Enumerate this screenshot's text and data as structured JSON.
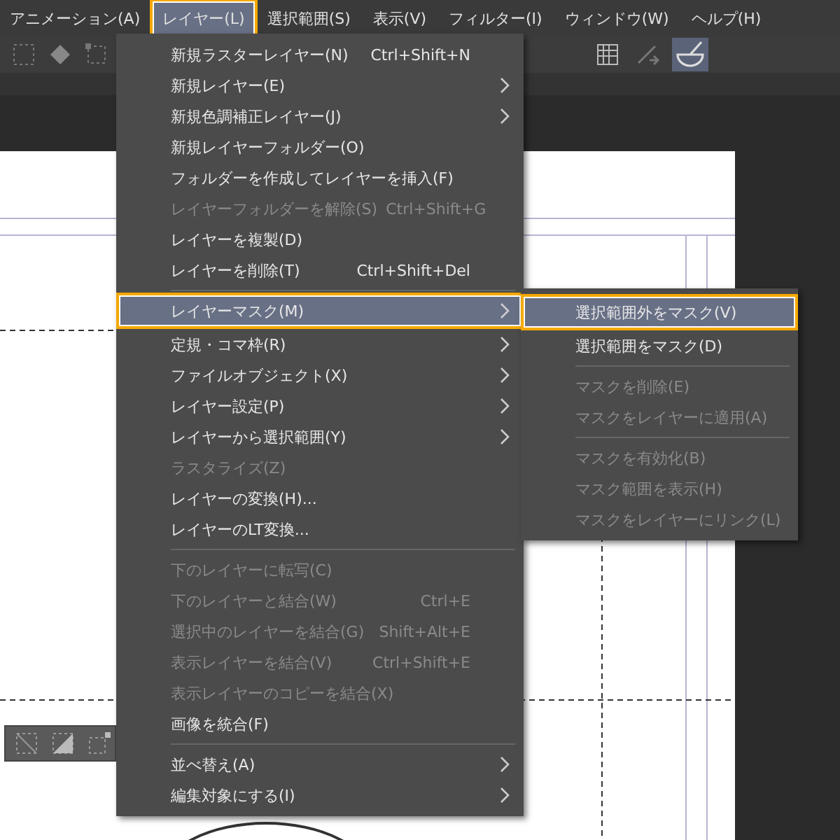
{
  "menu_bar": [
    {
      "label": "アニメーション(A)",
      "selected": false
    },
    {
      "label": "レイヤー(L)",
      "selected": true
    },
    {
      "label": "選択範囲(S)",
      "selected": false
    },
    {
      "label": "表示(V)",
      "selected": false
    },
    {
      "label": "フィルター(I)",
      "selected": false
    },
    {
      "label": "ウィンドウ(W)",
      "selected": false
    },
    {
      "label": "ヘルプ(H)",
      "selected": false
    }
  ],
  "layer_menu": [
    {
      "kind": "item",
      "label": "新規ラスターレイヤー(N)",
      "shortcut": "Ctrl+Shift+N",
      "submenu": false,
      "disabled": false,
      "selected": false
    },
    {
      "kind": "item",
      "label": "新規レイヤー(E)",
      "submenu": true,
      "disabled": false,
      "selected": false
    },
    {
      "kind": "item",
      "label": "新規色調補正レイヤー(J)",
      "submenu": true,
      "disabled": false,
      "selected": false
    },
    {
      "kind": "item",
      "label": "新規レイヤーフォルダー(O)",
      "submenu": false,
      "disabled": false,
      "selected": false
    },
    {
      "kind": "item",
      "label": "フォルダーを作成してレイヤーを挿入(F)",
      "submenu": false,
      "disabled": false,
      "selected": false
    },
    {
      "kind": "item",
      "label": "レイヤーフォルダーを解除(S)",
      "shortcut": "Ctrl+Shift+G",
      "submenu": false,
      "disabled": true,
      "selected": false
    },
    {
      "kind": "item",
      "label": "レイヤーを複製(D)",
      "submenu": false,
      "disabled": false,
      "selected": false
    },
    {
      "kind": "item",
      "label": "レイヤーを削除(T)",
      "shortcut": "Ctrl+Shift+Del",
      "submenu": false,
      "disabled": false,
      "selected": false
    },
    {
      "kind": "separator"
    },
    {
      "kind": "item",
      "label": "レイヤーマスク(M)",
      "submenu": true,
      "disabled": false,
      "selected": true
    },
    {
      "kind": "item",
      "label": "定規・コマ枠(R)",
      "submenu": true,
      "disabled": false,
      "selected": false
    },
    {
      "kind": "item",
      "label": "ファイルオブジェクト(X)",
      "submenu": true,
      "disabled": false,
      "selected": false
    },
    {
      "kind": "item",
      "label": "レイヤー設定(P)",
      "submenu": true,
      "disabled": false,
      "selected": false
    },
    {
      "kind": "item",
      "label": "レイヤーから選択範囲(Y)",
      "submenu": true,
      "disabled": false,
      "selected": false
    },
    {
      "kind": "item",
      "label": "ラスタライズ(Z)",
      "submenu": false,
      "disabled": true,
      "selected": false
    },
    {
      "kind": "item",
      "label": "レイヤーの変換(H)...",
      "submenu": false,
      "disabled": false,
      "selected": false
    },
    {
      "kind": "item",
      "label": "レイヤーのLT変換...",
      "submenu": false,
      "disabled": false,
      "selected": false
    },
    {
      "kind": "separator"
    },
    {
      "kind": "item",
      "label": "下のレイヤーに転写(C)",
      "submenu": false,
      "disabled": true,
      "selected": false
    },
    {
      "kind": "item",
      "label": "下のレイヤーと結合(W)",
      "shortcut": "Ctrl+E",
      "submenu": false,
      "disabled": true,
      "selected": false
    },
    {
      "kind": "item",
      "label": "選択中のレイヤーを結合(G)",
      "shortcut": "Shift+Alt+E",
      "submenu": false,
      "disabled": true,
      "selected": false
    },
    {
      "kind": "item",
      "label": "表示レイヤーを結合(V)",
      "shortcut": "Ctrl+Shift+E",
      "submenu": false,
      "disabled": true,
      "selected": false
    },
    {
      "kind": "item",
      "label": "表示レイヤーのコピーを結合(X)",
      "submenu": false,
      "disabled": true,
      "selected": false
    },
    {
      "kind": "item",
      "label": "画像を統合(F)",
      "submenu": false,
      "disabled": false,
      "selected": false
    },
    {
      "kind": "separator"
    },
    {
      "kind": "item",
      "label": "並べ替え(A)",
      "submenu": true,
      "disabled": false,
      "selected": false
    },
    {
      "kind": "item",
      "label": "編集対象にする(I)",
      "submenu": true,
      "disabled": false,
      "selected": false
    }
  ],
  "mask_submenu": [
    {
      "kind": "item",
      "label": "選択範囲外をマスク(V)",
      "disabled": false,
      "selected": true
    },
    {
      "kind": "item",
      "label": "選択範囲をマスク(D)",
      "disabled": false,
      "selected": false
    },
    {
      "kind": "separator"
    },
    {
      "kind": "item",
      "label": "マスクを削除(E)",
      "disabled": true,
      "selected": false
    },
    {
      "kind": "item",
      "label": "マスクをレイヤーに適用(A)",
      "disabled": true,
      "selected": false
    },
    {
      "kind": "separator"
    },
    {
      "kind": "item",
      "label": "マスクを有効化(B)",
      "disabled": true,
      "selected": false
    },
    {
      "kind": "item",
      "label": "マスク範囲を表示(H)",
      "disabled": true,
      "selected": false
    },
    {
      "kind": "item",
      "label": "マスクをレイヤーにリンク(L)",
      "disabled": true,
      "selected": false
    }
  ]
}
